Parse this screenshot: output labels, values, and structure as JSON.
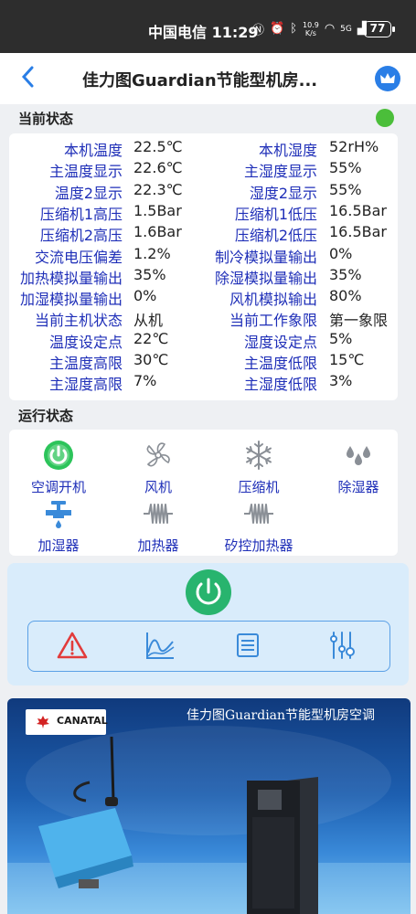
{
  "statusbar": {
    "carrier_time": "中国电信 11:29",
    "speed_value": "10.9",
    "speed_unit": "K/s",
    "network": "5G",
    "battery": "77"
  },
  "header": {
    "title": "佳力图Guardian节能型机房...",
    "back_icon": "chevron-left-icon",
    "crown_icon": "crown-icon"
  },
  "current_status": {
    "heading": "当前状态",
    "indicator_color": "#4bbe3a",
    "rows": [
      {
        "l1": "本机温度",
        "v1": "22.5℃",
        "l2": "本机湿度",
        "v2": "52rH%"
      },
      {
        "l1": "主温度显示",
        "v1": "22.6℃",
        "l2": "主湿度显示",
        "v2": "55%"
      },
      {
        "l1": "温度2显示",
        "v1": "22.3℃",
        "l2": "湿度2显示",
        "v2": "55%"
      },
      {
        "l1": "压缩机1高压",
        "v1": "1.5Bar",
        "l2": "压缩机1低压",
        "v2": "16.5Bar"
      },
      {
        "l1": "压缩机2高压",
        "v1": "1.6Bar",
        "l2": "压缩机2低压",
        "v2": "16.5Bar"
      },
      {
        "l1": "交流电压偏差",
        "v1": "1.2%",
        "l2": "制冷模拟量输出",
        "v2": "0%"
      },
      {
        "l1": "加热模拟量输出",
        "v1": "35%",
        "l2": "除湿模拟量输出",
        "v2": "35%"
      },
      {
        "l1": "加湿模拟量输出",
        "v1": "0%",
        "l2": "风机模拟输出",
        "v2": "80%"
      },
      {
        "l1": "当前主机状态",
        "v1": "从机",
        "l2": "当前工作象限",
        "v2": "第一象限"
      },
      {
        "l1": "温度设定点",
        "v1": "22℃",
        "l2": "湿度设定点",
        "v2": "5%"
      },
      {
        "l1": "主温度高限",
        "v1": "30℃",
        "l2": "主温度低限",
        "v2": "15℃"
      },
      {
        "l1": "主湿度高限",
        "v1": "7%",
        "l2": "主湿度低限",
        "v2": "3%"
      }
    ]
  },
  "run_status": {
    "heading": "运行状态",
    "items": [
      {
        "label": "空调开机",
        "icon": "power-on-icon"
      },
      {
        "label": "风机",
        "icon": "fan-icon"
      },
      {
        "label": "压缩机",
        "icon": "snowflake-icon"
      },
      {
        "label": "除湿器",
        "icon": "droplets-icon"
      },
      {
        "label": "加湿器",
        "icon": "humidifier-icon"
      },
      {
        "label": "加热器",
        "icon": "heater-icon"
      },
      {
        "label": "矽控加热器",
        "icon": "scr-heater-icon"
      }
    ]
  },
  "controls": {
    "power_color": "#28b46e",
    "tools": [
      "alarm-icon",
      "chart-icon",
      "list-icon",
      "settings-sliders-icon"
    ]
  },
  "banner": {
    "logo": "CANATAL",
    "title": "佳力图Guardian节能型机房空调"
  }
}
